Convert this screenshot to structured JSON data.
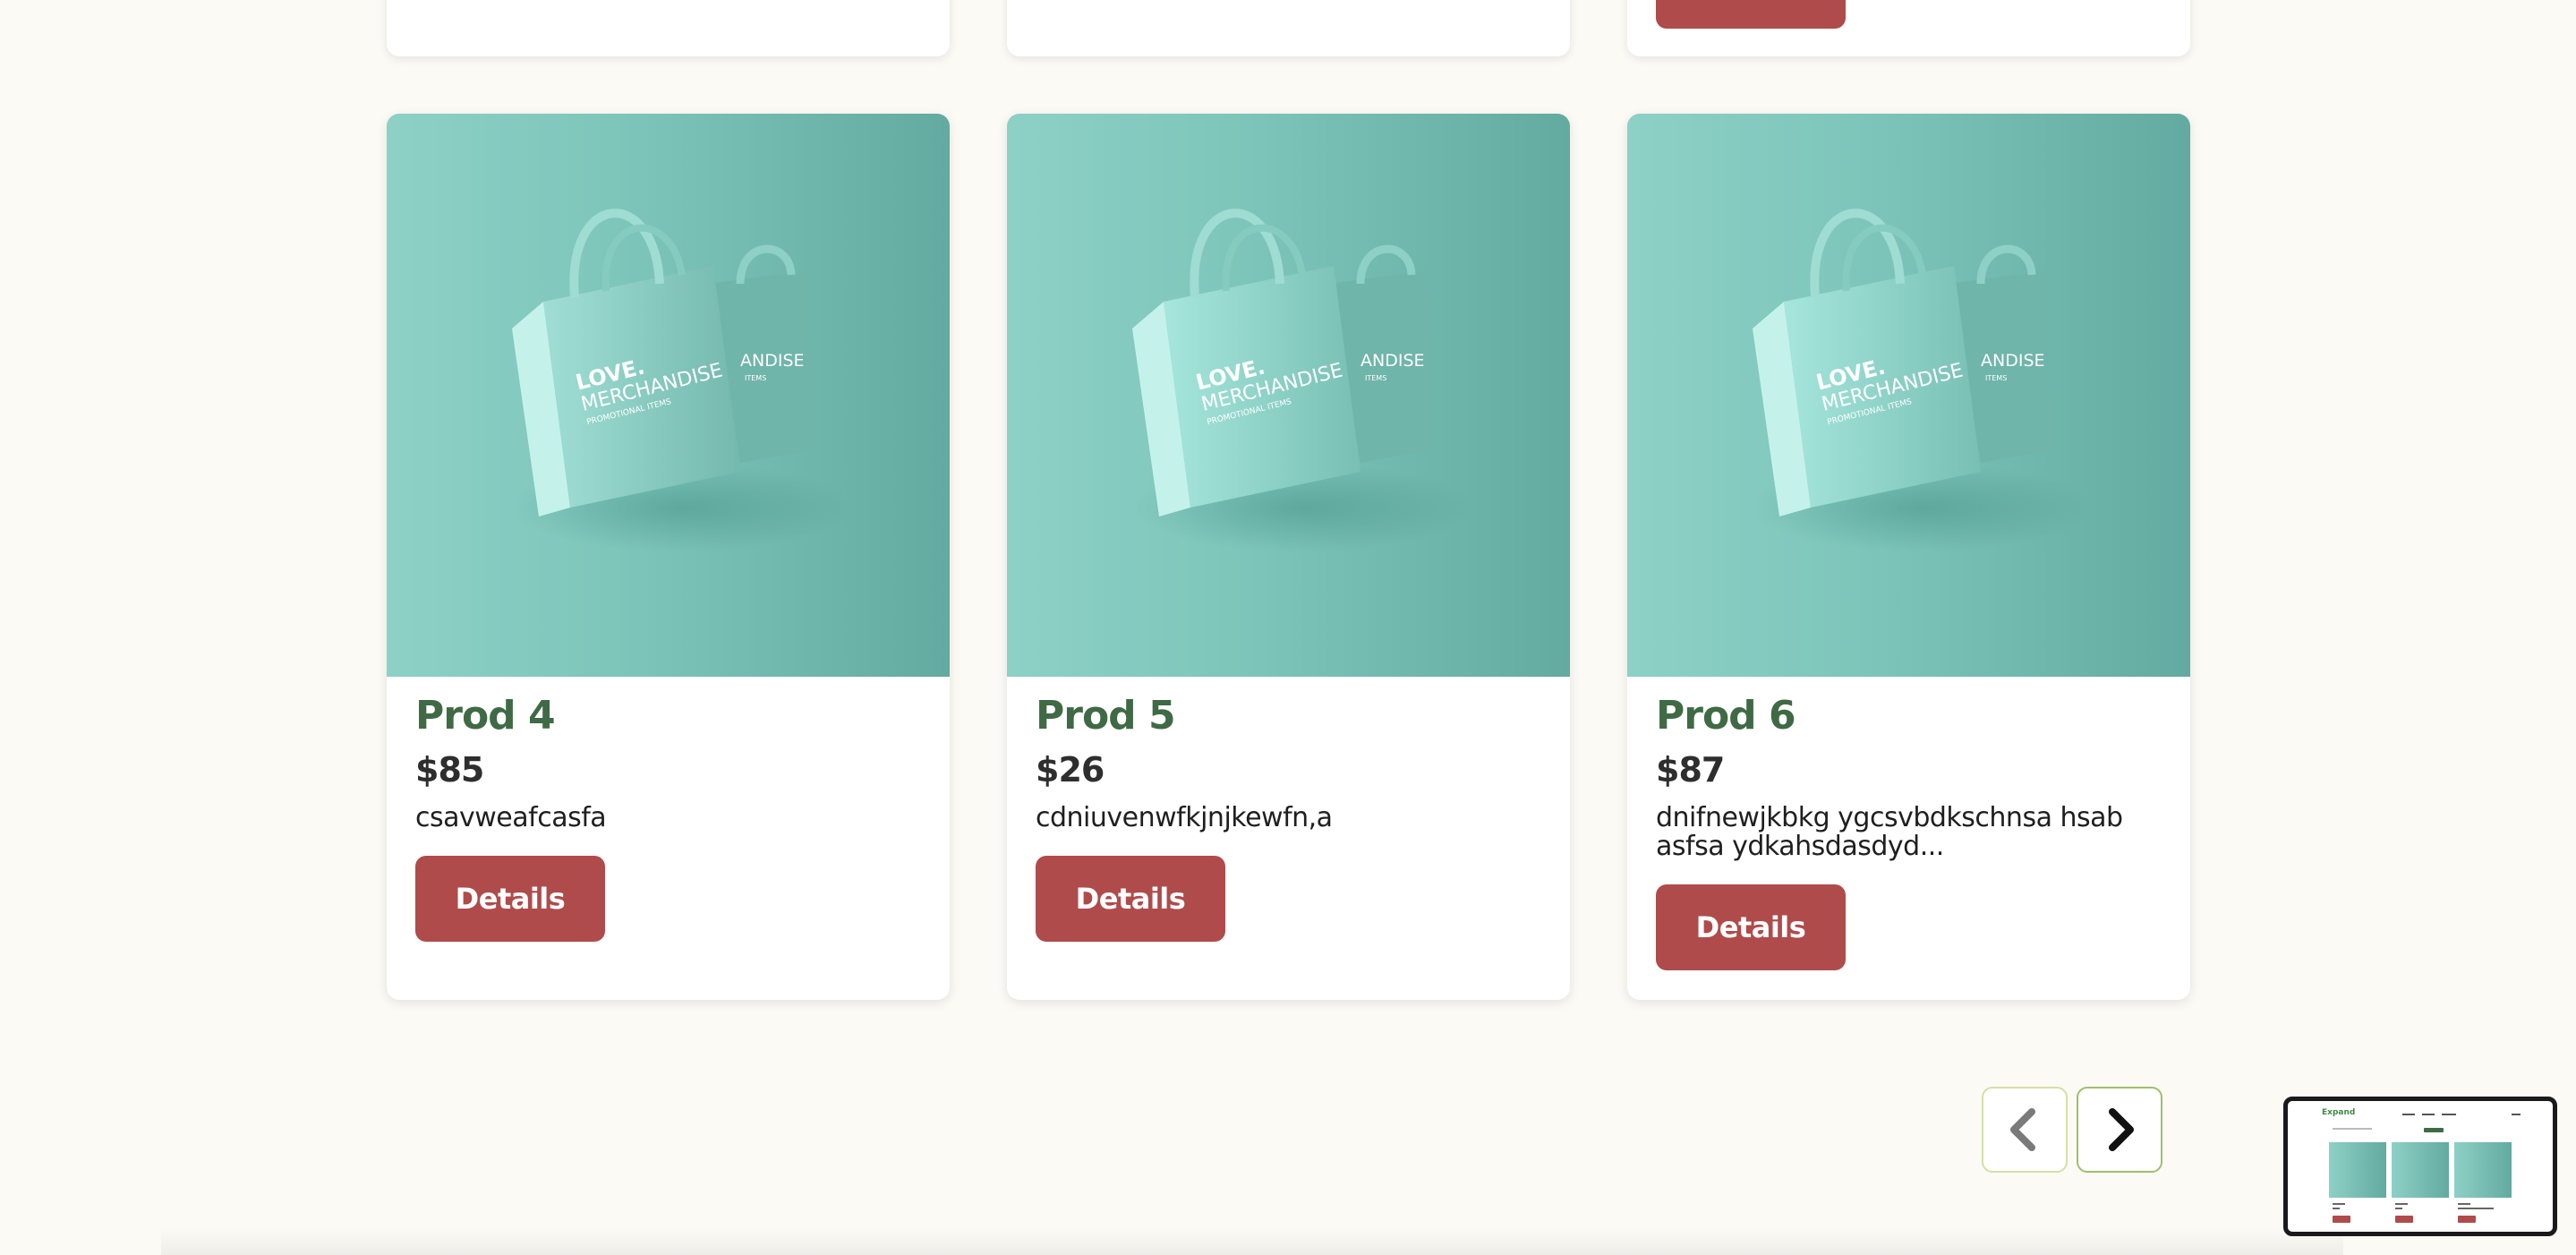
{
  "colors": {
    "page_background": "#fbfaf5",
    "title_green": "#3f6a45",
    "button_red": "#b04b4b",
    "image_teal": "#7cc4b9"
  },
  "products": [
    {
      "name": "Prod 4",
      "price": "$85",
      "description": "csavweafcasfa",
      "button_label": "Details",
      "image_text": {
        "brand": "LOVE.",
        "line": "MERCHANDISE",
        "sub": "PROMOTIONAL ITEMS",
        "back_text": "ANDISE",
        "back_sub": "ITEMS"
      }
    },
    {
      "name": "Prod 5",
      "price": "$26",
      "description": "cdniuvenwfkjnjkewfn,a",
      "button_label": "Details",
      "image_text": {
        "brand": "LOVE.",
        "line": "MERCHANDISE",
        "sub": "PROMOTIONAL ITEMS",
        "back_text": "ANDISE",
        "back_sub": "ITEMS"
      }
    },
    {
      "name": "Prod 6",
      "price": "$87",
      "description": "dnifnewjkbkg ygcsvbdkschnsa hsab asfsa ydkahsdasdyd...",
      "button_label": "Details",
      "image_text": {
        "brand": "LOVE.",
        "line": "MERCHANDISE",
        "sub": "PROMOTIONAL ITEMS",
        "back_text": "ANDISE",
        "back_sub": "ITEMS"
      }
    }
  ],
  "pagination": {
    "prev_icon": "chevron-left-icon",
    "next_icon": "chevron-right-icon"
  },
  "minimap": {
    "logo": "Expand"
  }
}
